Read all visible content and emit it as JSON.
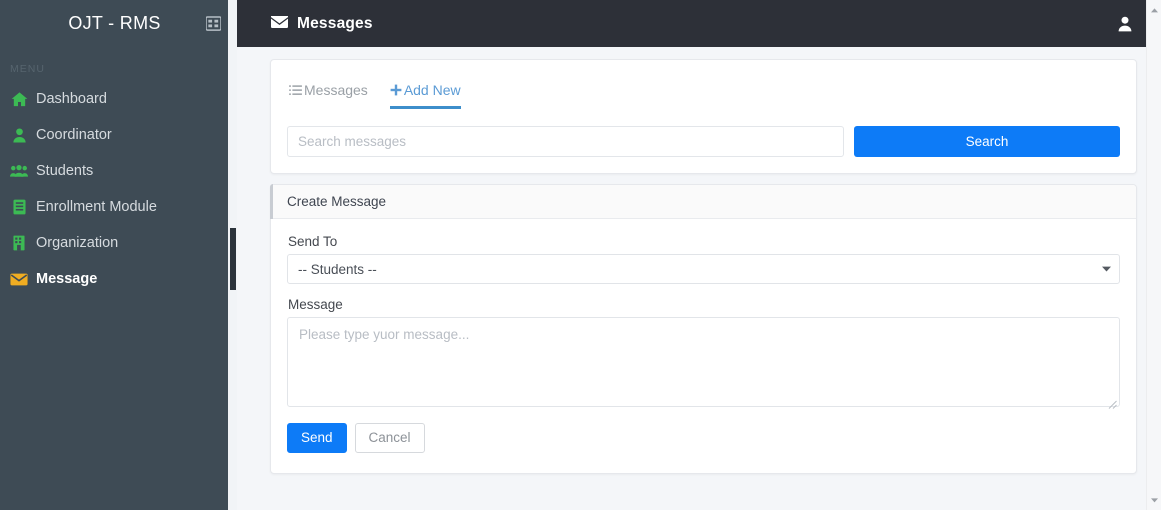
{
  "sidebar": {
    "brand": "OJT - RMS",
    "toggle_icon": "grid-icon",
    "menu_label": "MENU",
    "items": [
      {
        "label": "Dashboard",
        "icon": "home-icon",
        "color": "#3cba54",
        "active": false
      },
      {
        "label": "Coordinator",
        "icon": "user-icon",
        "color": "#3cba54",
        "active": false
      },
      {
        "label": "Students",
        "icon": "users-icon",
        "color": "#3cba54",
        "active": false
      },
      {
        "label": "Enrollment Module",
        "icon": "book-icon",
        "color": "#3cba54",
        "active": false
      },
      {
        "label": "Organization",
        "icon": "building-icon",
        "color": "#3cba54",
        "active": false
      },
      {
        "label": "Message",
        "icon": "envelope-icon",
        "color": "#f0ad22",
        "active": true
      }
    ],
    "background_color": "#3e4b55"
  },
  "topbar": {
    "title": "Messages",
    "title_icon": "envelope-icon",
    "account_icon": "user-icon",
    "background_color": "#2d3038"
  },
  "tabs_card": {
    "tabs": [
      {
        "label": "Messages",
        "icon": "list-icon",
        "active": false
      },
      {
        "label": "Add New",
        "icon": "plus-icon",
        "active": true
      }
    ],
    "search": {
      "placeholder": "Search messages",
      "value": "",
      "button_label": "Search",
      "button_color": "#0d7bf7"
    }
  },
  "create_card": {
    "header": "Create Message",
    "send_to_label": "Send To",
    "send_to_value": "-- Students --",
    "send_to_options": [
      "-- Students --"
    ],
    "message_label": "Message",
    "message_placeholder": "Please type yuor message...",
    "message_value": "",
    "send_label": "Send",
    "cancel_label": "Cancel"
  }
}
